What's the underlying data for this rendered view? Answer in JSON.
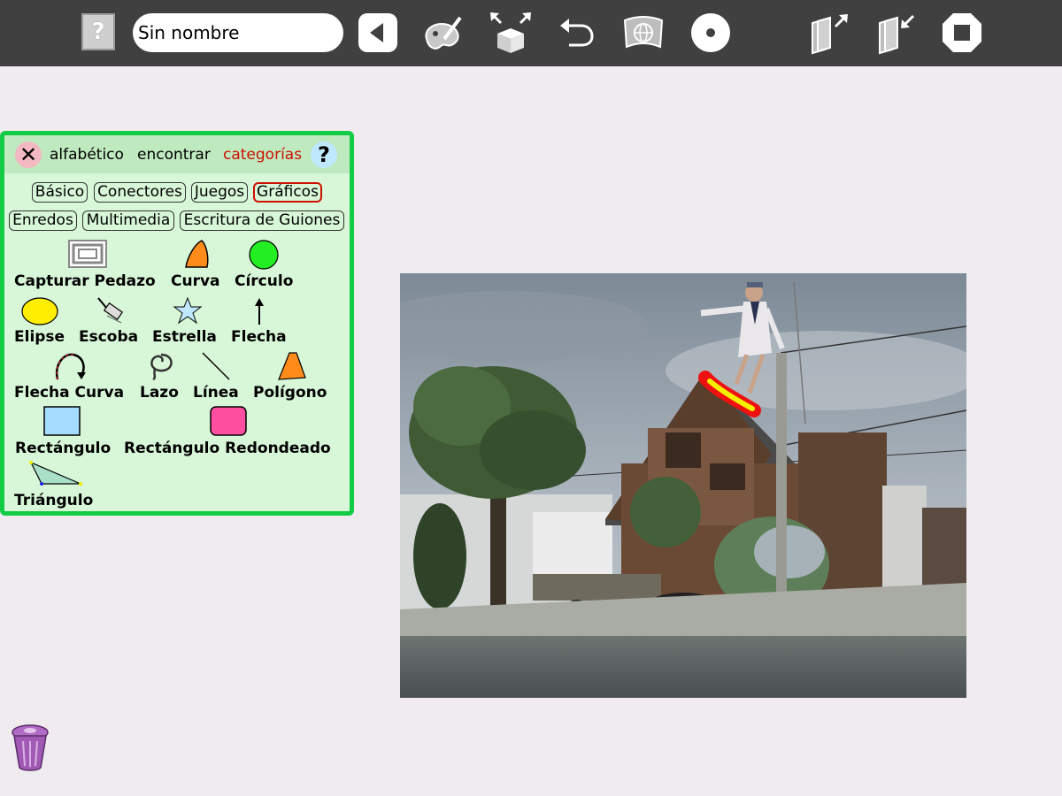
{
  "toolbar": {
    "help_label": "?",
    "title_value": "Sin nombre",
    "icons": [
      "help-icon",
      "back-icon",
      "paint-icon",
      "box-arrows-icon",
      "undo-icon",
      "web-icon",
      "record-icon",
      "export-icon",
      "import-icon",
      "stop-icon"
    ]
  },
  "palette": {
    "close_label": "✕",
    "help_label": "?",
    "tabs": [
      {
        "label": "alfabético"
      },
      {
        "label": "encontrar"
      },
      {
        "label": "categorías"
      }
    ],
    "categories": [
      {
        "label": "Básico"
      },
      {
        "label": "Conectores"
      },
      {
        "label": "Juegos"
      },
      {
        "label": "Gráficos"
      },
      {
        "label": "Enredos"
      },
      {
        "label": "Multimedia"
      },
      {
        "label": "Escritura de Guiones"
      }
    ],
    "tools": [
      {
        "label": "Capturar Pedazo"
      },
      {
        "label": "Curva"
      },
      {
        "label": "Círculo"
      },
      {
        "label": "Elipse"
      },
      {
        "label": "Escoba"
      },
      {
        "label": "Estrella"
      },
      {
        "label": "Flecha"
      },
      {
        "label": "Flecha Curva"
      },
      {
        "label": "Lazo"
      },
      {
        "label": "Línea"
      },
      {
        "label": "Polígono"
      },
      {
        "label": "Rectángulo"
      },
      {
        "label": "Rectángulo Redondeado"
      },
      {
        "label": "Triángulo"
      }
    ]
  },
  "colors": {
    "toolbar_bg": "#404040",
    "palette_border": "#11cc44",
    "palette_bg": "#d8f7d8",
    "active_tab": "#cc1100",
    "background": "#efebee"
  }
}
